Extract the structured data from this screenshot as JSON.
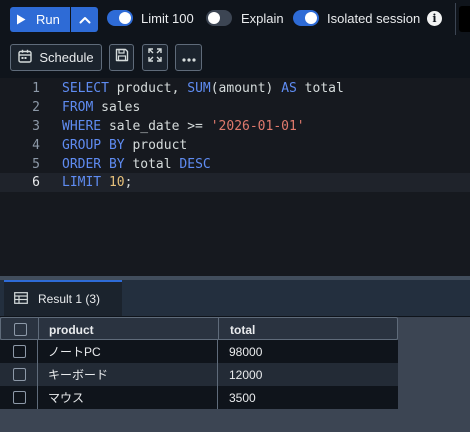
{
  "toolbar": {
    "run_label": "Run",
    "limit_label": "Limit 100",
    "limit_on": true,
    "explain_label": "Explain",
    "explain_on": false,
    "isolated_label": "Isolated session",
    "isolated_on": true,
    "info_glyph": "i",
    "schedule_label": "Schedule"
  },
  "editor": {
    "line_numbers": [
      "1",
      "2",
      "3",
      "4",
      "5",
      "6"
    ],
    "active_line": 6
  },
  "results": {
    "tab_label": "Result 1",
    "tab_count": "(3)",
    "columns": [
      "product",
      "total"
    ],
    "rows": [
      [
        "ノートPC",
        "98000"
      ],
      [
        "キーボード",
        "12000"
      ],
      [
        "マウス",
        "3500"
      ]
    ]
  },
  "colors": {
    "accent": "#2e6bd6",
    "keyword": "#5f8cf2",
    "string": "#e07a6d",
    "number": "#e6c07b",
    "background": "#0f141b"
  },
  "icons": [
    "play-icon",
    "chevron-up-icon",
    "info-icon",
    "calendar-icon",
    "save-icon",
    "expand-icon",
    "more-icon",
    "table-icon",
    "checkbox-icon"
  ]
}
